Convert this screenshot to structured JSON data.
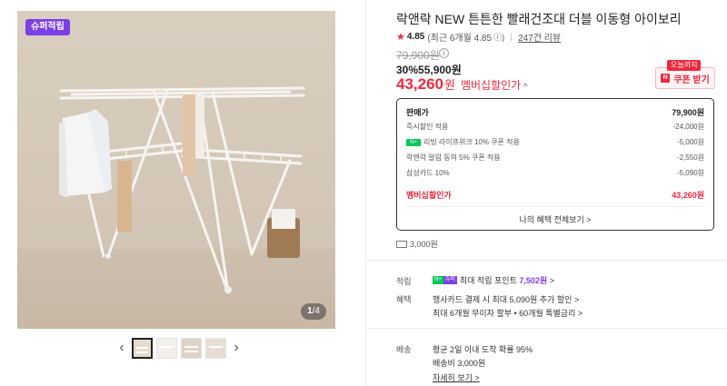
{
  "gallery": {
    "badge": "슈퍼적립",
    "page_current": "1",
    "page_total": "/4",
    "prev_icon": "chevron-left-icon",
    "next_icon": "chevron-right-icon"
  },
  "product": {
    "title": "락앤락 NEW 튼튼한 빨래건조대 더블 이동형 아이보리",
    "rating": "4.85",
    "rating_recent": "(최근 6개월 4.85",
    "review_count": "247건 리뷰",
    "original_price": "79,900원",
    "discount_line": "30%55,900원",
    "member_price": "43,260",
    "member_won": "원",
    "member_label": "멤버십할인가",
    "member_caret": "^"
  },
  "coupon": {
    "today": "오늘까지",
    "button": "쿠폰 받기"
  },
  "price_box": {
    "rows": [
      {
        "label": "판매가",
        "value": "79,900원"
      },
      {
        "label": "즉시할인 적용",
        "value": "-24,000원"
      },
      {
        "label": "리빙 라이프위크 10% 쿠폰 적용",
        "value": "-5,000원"
      },
      {
        "label": "락앤락 알림 동의 5% 쿠폰 적용",
        "value": "-2,550원"
      },
      {
        "label": "삼성카드 10%",
        "value": "-5,090원"
      }
    ],
    "total_label": "멤버십할인가",
    "total_value": "43,260원",
    "view_all": "나의 혜택 전체보기 >"
  },
  "shipping": {
    "fee": "3,000원"
  },
  "benefits": {
    "point_label": "적립",
    "point_text": "최대 적립 포인트",
    "point_value": "7,502원",
    "point_arrow": ">",
    "benefit_label": "혜택",
    "benefit_line1": "행사카드 결제 시 최대 5,090원 추가 할인 >",
    "benefit_line2": "최대 6개월 무이자 할부 • 60개월 특별금리 >"
  },
  "delivery": {
    "label": "배송",
    "line1": "평균 2일 이내 도착 확률 95%",
    "line2": "배송비 3,000원",
    "detail": "자세히 보기 >"
  },
  "colors": {
    "accent_red": "#f0283d",
    "super_purple": "#7b3fe4",
    "naver_green": "#03c75a"
  }
}
